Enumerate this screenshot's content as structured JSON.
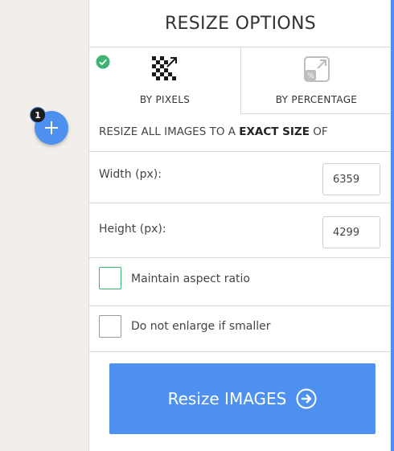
{
  "upload": {
    "file_count": "1",
    "add_icon": "plus-icon"
  },
  "panel": {
    "title": "RESIZE OPTIONS",
    "tabs": [
      {
        "label": "BY PIXELS",
        "icon": "pixels-resize-icon",
        "selected": true,
        "status_icon": "check-circle-icon"
      },
      {
        "label": "BY PERCENTAGE",
        "icon": "percentage-resize-icon",
        "selected": false
      }
    ],
    "description": {
      "prefix": "RESIZE ALL IMAGES TO A ",
      "emphasis": "EXACT SIZE",
      "suffix": " OF"
    },
    "width": {
      "label": "Width (px):",
      "value": "6359"
    },
    "height": {
      "label": "Height (px):",
      "value": "4299"
    },
    "options": [
      {
        "label": "Maintain aspect ratio",
        "checked": false
      },
      {
        "label": "Do not enlarge if smaller",
        "checked": false
      }
    ],
    "action": {
      "label": "Resize IMAGES",
      "icon": "arrow-right-circle-icon"
    }
  },
  "colors": {
    "accent": "#4d90f0",
    "success": "#3cb371",
    "badge": "#1c1c1c",
    "sidebar_bg": "#f2efea"
  }
}
